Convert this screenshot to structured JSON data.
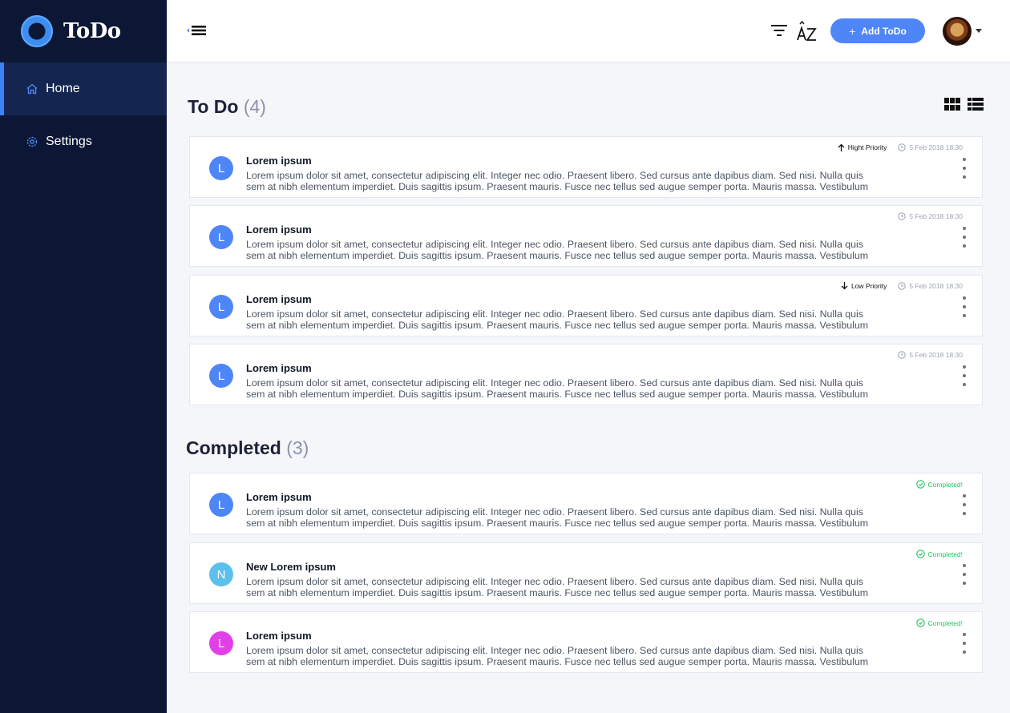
{
  "app": {
    "name": "ToDo"
  },
  "sidebar": {
    "items": [
      {
        "label": "Home",
        "icon": "home-icon",
        "active": true
      },
      {
        "label": "Settings",
        "icon": "gear-icon",
        "active": false
      }
    ]
  },
  "topbar": {
    "add_label": "Add ToDo",
    "icons": [
      "menu-collapse-icon",
      "filter-icon",
      "sort-az-icon",
      "avatar",
      "chevron-down-icon"
    ]
  },
  "todo": {
    "title": "To Do",
    "count": "(4)",
    "items": [
      {
        "initial": "L",
        "color": "#4f86f7",
        "title": "Lorem ipsum",
        "line1": "Lorem ipsum dolor sit amet, consectetur adipiscing elit. Integer nec odio. Praesent libero. Sed cursus ante dapibus diam. Sed nisi. Nulla quis",
        "line2": "sem at nibh elementum imperdiet. Duis sagittis ipsum. Praesent mauris. Fusce nec tellus sed augue semper porta. Mauris massa. Vestibulum",
        "priority": "Hight Priority",
        "date": "5 Feb 2018 18:30"
      },
      {
        "initial": "L",
        "color": "#4f86f7",
        "title": "Lorem ipsum",
        "line1": "Lorem ipsum dolor sit amet, consectetur adipiscing elit. Integer nec odio. Praesent libero. Sed cursus ante dapibus diam. Sed nisi. Nulla quis",
        "line2": "sem at nibh elementum imperdiet. Duis sagittis ipsum. Praesent mauris. Fusce nec tellus sed augue semper porta. Mauris massa. Vestibulum",
        "date": "5 Feb 2018 18:30"
      },
      {
        "initial": "L",
        "color": "#4f86f7",
        "title": "Lorem ipsum",
        "line1": "Lorem ipsum dolor sit amet, consectetur adipiscing elit. Integer nec odio. Praesent libero. Sed cursus ante dapibus diam. Sed nisi. Nulla quis",
        "line2": "sem at nibh elementum imperdiet. Duis sagittis ipsum. Praesent mauris. Fusce nec tellus sed augue semper porta. Mauris massa. Vestibulum",
        "priority": "Low Priority",
        "date": "5 Feb 2018 18:30"
      },
      {
        "initial": "L",
        "color": "#4f86f7",
        "title": "Lorem ipsum",
        "line1": "Lorem ipsum dolor sit amet, consectetur adipiscing elit. Integer nec odio. Praesent libero. Sed cursus ante dapibus diam. Sed nisi. Nulla quis",
        "line2": "sem at nibh elementum imperdiet. Duis sagittis ipsum. Praesent mauris. Fusce nec tellus sed augue semper porta. Mauris massa. Vestibulum",
        "date": "5 Feb 2018 18:30"
      }
    ]
  },
  "completed": {
    "title": "Completed",
    "count": "(3)",
    "status_label": "Completed!",
    "items": [
      {
        "initial": "L",
        "color": "#4f86f7",
        "title": "Lorem ipsum",
        "line1": "Lorem ipsum dolor sit amet, consectetur adipiscing elit. Integer nec odio. Praesent libero. Sed cursus ante dapibus diam. Sed nisi. Nulla quis",
        "line2": "sem at nibh elementum imperdiet. Duis sagittis ipsum. Praesent mauris. Fusce nec tellus sed augue semper porta. Mauris massa. Vestibulum"
      },
      {
        "initial": "N",
        "color": "#5bc0eb",
        "title": "New Lorem ipsum",
        "line1": "Lorem ipsum dolor sit amet, consectetur adipiscing elit. Integer nec odio. Praesent libero. Sed cursus ante dapibus diam. Sed nisi. Nulla quis",
        "line2": "sem at nibh elementum imperdiet. Duis sagittis ipsum. Praesent mauris. Fusce nec tellus sed augue semper porta. Mauris massa. Vestibulum"
      },
      {
        "initial": "L",
        "color": "#e040e6",
        "title": "Lorem ipsum",
        "line1": "Lorem ipsum dolor sit amet, consectetur adipiscing elit. Integer nec odio. Praesent libero. Sed cursus ante dapibus diam. Sed nisi. Nulla quis",
        "line2": "sem at nibh elementum imperdiet. Duis sagittis ipsum. Praesent mauris. Fusce nec tellus sed augue semper porta. Mauris massa. Vestibulum"
      }
    ]
  },
  "colors": {
    "sidebar": "#0c1736",
    "accent": "#4f86f7",
    "completed": "#22c55e"
  }
}
